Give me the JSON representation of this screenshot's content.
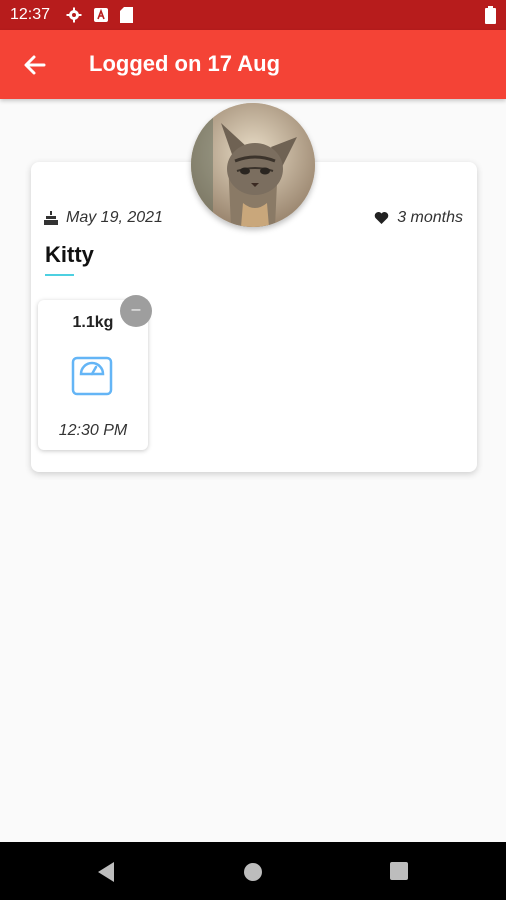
{
  "status_bar": {
    "time": "12:37",
    "icons": [
      "settings-icon",
      "a-icon",
      "sd-card-icon",
      "battery-icon"
    ]
  },
  "app_bar": {
    "title": "Logged on 17 Aug",
    "back_icon": "arrow-back-icon",
    "color": "#f44336"
  },
  "pet": {
    "name": "Kitty",
    "birth_date": "May 19, 2021",
    "age": "3 months",
    "accent_color": "#4dd0e1"
  },
  "logs": [
    {
      "weight": "1.1kg",
      "time": "12:30 PM",
      "icon": "scale-icon",
      "delete_label": "–"
    }
  ],
  "nav_bar": {
    "buttons": [
      "back",
      "home",
      "recents"
    ]
  }
}
